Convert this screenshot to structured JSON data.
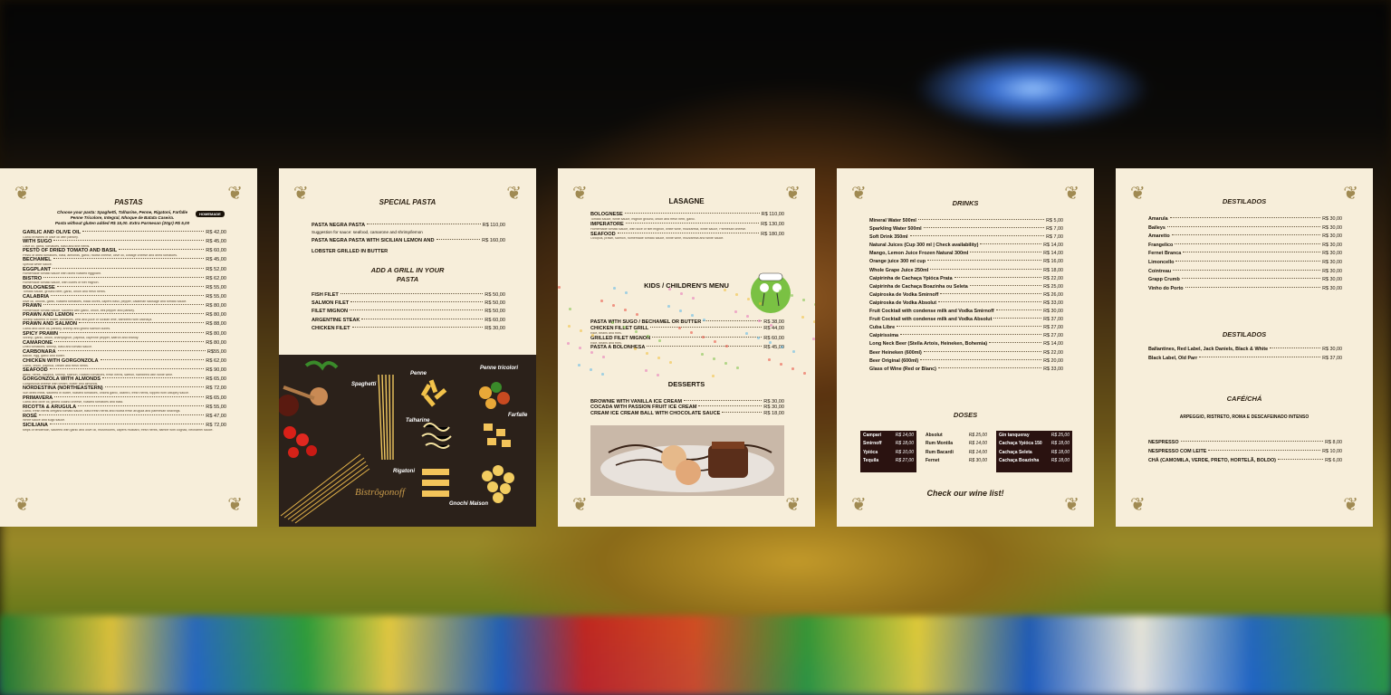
{
  "pastas": {
    "title": "PASTAS",
    "intro": [
      "Choose your pasta: Spaghetti, Talharine, Penne, Rigatoni, Farfalle",
      "Penne Tricolore, Integral, Nhoque de Batata Caseira.",
      "Pasta without gluten added R$ 15,00. Extra Parmesan (20gr) R$ 5,00"
    ],
    "badge": "HOMEMADE",
    "items": [
      {
        "name": "GARLIC AND OLIVE OIL",
        "price": "R$ 42,00",
        "desc": "Garlic browned in olive oil with parsley."
      },
      {
        "name": "WITH SUGO",
        "price": "R$ 45,00",
        "desc": "Olive oil, garlic, tomatoes, basil and fine herbs."
      },
      {
        "name": "PESTO OF DRIED TOMATO AND BASIL",
        "price": "R$ 60,00",
        "desc": "Pesto of dried tomatoes, basil, almonds, garlic, ricotta cheese, olive oil, cottage cheese and dried tomatoes."
      },
      {
        "name": "BECHAMEL",
        "price": "R$ 45,00",
        "desc": "Special white sauce."
      },
      {
        "name": "EGGPLANT",
        "price": "R$ 52,00",
        "desc": "Homemade tomato sauce with diced roasted eggplant."
      },
      {
        "name": "BISTRO",
        "price": "R$ 62,00",
        "desc": "Homemade tomato sauce, with cubes of filet mignon."
      },
      {
        "name": "BOLOGNESE",
        "price": "R$ 55,00",
        "desc": "Tomato sauce, ground beef, garlic, onion and fresh herbs."
      },
      {
        "name": "CALABRIA",
        "price": "R$ 55,00",
        "desc": "olive oil, onions, garlic, roasted tomatoes, black olives, capers basil, pepper, calabrian sausage and tomato sauce."
      },
      {
        "name": "PRAWN",
        "price": "R$ 80,00",
        "desc": "Homemade tomato sauce, sautéed with garlic, onion, bell pepper and parsley."
      },
      {
        "name": "PRAWN AND LEMON",
        "price": "R$ 80,00",
        "desc": "Shrimp sautéed in butter, tomatoes, zest and juice of Sicilian lime, flambéed with cachaça."
      },
      {
        "name": "PRAWN AND SALMON",
        "price": "R$ 88,00",
        "desc": "Garlic and olive oil, parsley, shrimp and grilled salmon cubes."
      },
      {
        "name": "SPICY PRAWN",
        "price": "R$ 80,00",
        "desc": "Shrimp, garlic, onion, champignon, paprika, cayenne pepper, saffron and brandy."
      },
      {
        "name": "CAMARONE",
        "price": "R$ 80,00",
        "desc": "Dried tomatoes, shrimp, basil and tomato sauce."
      },
      {
        "name": "CARBONARA",
        "price": "R$55,00",
        "desc": "Bacon, egg, garlic and butter."
      },
      {
        "name": "CHICKEN WITH GORGONZOLA",
        "price": "R$ 62,00",
        "desc": "Garlic, onion, paprika, cream and fresh herbs."
      },
      {
        "name": "SEAFOOD",
        "price": "R$ 90,00",
        "desc": "garlic, herbs, octopus, shrimp, salmon, roasted tomatoes, fresh herbs, saffron, flambéed with white wine."
      },
      {
        "name": "GORGONZOLA WITH ALMONDS",
        "price": "R$ 65,00",
        "desc": "Gorgonzola cheese with cream, butter and almonds."
      },
      {
        "name": "NORDESTINA (NORTHEASTERN)",
        "price": "R$ 72,00",
        "desc": "Sun dried meat, sautéed in butter, roasted tomatoes, onions garlic, cilantro, fresh herbs, topped with catupiry sauce."
      },
      {
        "name": "PRIMAVERA",
        "price": "R$ 65,00",
        "desc": "Garlic and olive oil, grilled coalho cheese, roasted tomatoes and basil."
      },
      {
        "name": "RICOTTA & ARUGULA",
        "price": "R$ 55,00",
        "desc": "Garlic, fresh herbs oregano tomato sauce, basil fresh herbs and ricotta fresh arugula and parmesan shavings."
      },
      {
        "name": "ROSÉ",
        "price": "R$ 47,00",
        "desc": "White sauce and sugo sauce."
      },
      {
        "name": "SICILIANA",
        "price": "R$ 72,00",
        "desc": "strips of tenderloin, sautéed with garlic and olive oil, mushrooms, capers mustard, fresh herbs, flambé with cognac, béchamel sauce."
      }
    ]
  },
  "special": {
    "title": "SPECIAL PASTA",
    "items": [
      {
        "name": "PASTA NEGRA PASTA",
        "price": "R$ 110,00"
      },
      {
        "name": "PASTA NEGRA PASTA WITH SICILIAN LEMON AND",
        "price": "R$ 160,00"
      }
    ],
    "note": "Suggestion for sauce: seafood, camarone and shrimp/lemon",
    "lobster": "LOBSTER GRILLED IN BUTTER",
    "grill_title": "ADD A GRILL IN YOUR PASTA",
    "grill": [
      {
        "name": "FISH FILET",
        "price": "R$ 50,00"
      },
      {
        "name": "SALMON FILET",
        "price": "R$ 50,00"
      },
      {
        "name": "FILET MIGNON",
        "price": "R$ 50,00"
      },
      {
        "name": "ARGENTINE STEAK",
        "price": "R$ 60,00"
      },
      {
        "name": "CHICKEN FILET",
        "price": "R$ 30,00"
      }
    ],
    "labels": {
      "spaghetti": "Spaghetti",
      "penne": "Penne",
      "penne_tri": "Penne tricolori",
      "talharine": "Talharine",
      "farfalle": "Farfalle",
      "rigatoni": "Rigatoni",
      "gnocchi": "Gnochi Maison"
    },
    "logo": "Bistrôgonoff"
  },
  "lasagne": {
    "title": "LASAGNE",
    "items": [
      {
        "name": "BOLOGNESE",
        "price": "R$ 110,00",
        "desc": "Tomato sauce, white sauce, mignon ground, onion and fresh herb, garlic."
      },
      {
        "name": "IMPERATORE",
        "price": "R$ 130,00",
        "desc": "Homemade tomato sauce, with slice of filet mignon, white wine, mozzarella, white sauce, Parmesan cheese."
      },
      {
        "name": "SEAFOOD",
        "price": "R$ 180,00",
        "desc": "Octopus, prawn, salmon, homemade tomato sauce, white wine, mozzarella and white sauce."
      }
    ],
    "kids_title": "KIDS / CHILDREN'S MENU",
    "kids": [
      {
        "name": "PASTA WITH SUGO / BECHAMEL OR BUTTER",
        "price": "R$ 38,00",
        "desc": ""
      },
      {
        "name": "CHICKEN FILLET GRILL",
        "price": "R$ 44,00",
        "desc": "Rice, beans and fries."
      },
      {
        "name": "GRILLED FILET MIGNON",
        "price": "R$ 60,00",
        "desc": "Rice, beans and fries."
      },
      {
        "name": "PASTA A BOLONHESA",
        "price": "R$ 45,00",
        "desc": ""
      }
    ],
    "desserts_title": "DESSERTS",
    "desserts": [
      {
        "name": "BROWNIE WITH VANILLA ICE CREAM",
        "price": "R$ 30,00"
      },
      {
        "name": "COCADA WITH PASSION FRUIT ICE CREAM",
        "price": "R$ 30,00"
      },
      {
        "name": "CREAM ICE CREAM BALL WITH CHOCOLATE SAUCE",
        "price": "R$ 18,00"
      }
    ]
  },
  "drinks": {
    "title": "DRINKS",
    "items": [
      {
        "name": "Mineral Water 500ml",
        "price": "R$ 5,00"
      },
      {
        "name": "Sparkling Water 500ml",
        "price": "R$ 7,00"
      },
      {
        "name": "Soft Drink 350ml",
        "price": "R$ 7,00"
      },
      {
        "name": "Natural Juices (Cup 300 ml | Check availability)",
        "price": "R$ 14,00"
      },
      {
        "name": "Mango, Lemon Juice Frozen Natural 300ml",
        "price": "R$ 14,00"
      },
      {
        "name": "Orange juice 300 ml cup",
        "price": "R$ 16,00"
      },
      {
        "name": "Whole Grape Juice 250ml",
        "price": "R$ 18,00"
      },
      {
        "name": "Caipirinha de Cachaça Ypióca Prata",
        "price": "R$ 22,00"
      },
      {
        "name": "Caipirinha de Cachaça Boazinha ou Seleta",
        "price": "R$ 25,00"
      },
      {
        "name": "Caipiroska de Vodka Smirnoff",
        "price": "R$ 26,00"
      },
      {
        "name": "Caipiroska de Vodka Absolut",
        "price": "R$ 33,00"
      },
      {
        "name": "Fruit Cocktail with condense milk and Vodka Smirnoff",
        "price": "R$ 30,00"
      },
      {
        "name": "Fruit Cocktail with condense milk and Vodka Absolut",
        "price": "R$ 37,00"
      },
      {
        "name": "Cuba Libre",
        "price": "R$ 27,00"
      },
      {
        "name": "Caipirissima",
        "price": "R$ 27,00"
      },
      {
        "name": "Long Neck Beer (Stella Artois, Heineken, Bohemia)",
        "price": "R$ 14,00"
      },
      {
        "name": "Beer Heineken (600ml)",
        "price": "R$ 22,00"
      },
      {
        "name": "Beer Original (600ml)",
        "price": "R$ 20,00"
      },
      {
        "name": "Glass of  Wine (Red or Blanc)",
        "price": "R$ 33,00"
      }
    ],
    "doses_title": "DOSES",
    "doses_left": [
      {
        "name": "Campari",
        "price": "R$ 14,00"
      },
      {
        "name": "Smirnoff",
        "price": "R$ 18,00"
      },
      {
        "name": "Ypióca",
        "price": "R$ 10,00"
      },
      {
        "name": "Tequila",
        "price": "R$ 27,00"
      }
    ],
    "doses_mid": [
      {
        "name": "Absolut",
        "price": "R$ 25,00"
      },
      {
        "name": "Rum Montila",
        "price": "R$ 14,00"
      },
      {
        "name": "Rum Bacardi",
        "price": "R$ 14,00"
      },
      {
        "name": "Fernet",
        "price": "R$ 30,00"
      }
    ],
    "doses_right": [
      {
        "name": "Gin tanqueray",
        "price": "R$ 25,00"
      },
      {
        "name": "Cachaça Ypióca 150",
        "price": "R$ 18,00"
      },
      {
        "name": "Cachaça Seleta",
        "price": "R$ 18,00"
      },
      {
        "name": "Cachaça Boazinha",
        "price": "R$ 18,00"
      }
    ],
    "wine_note": "Check our wine list!"
  },
  "destilados": {
    "title": "DESTILADOS",
    "items": [
      {
        "name": "Amarula",
        "price": "R$ 30,00"
      },
      {
        "name": "Baileys",
        "price": "R$ 30,00"
      },
      {
        "name": "Amaretto",
        "price": "R$ 30,00"
      },
      {
        "name": "Frangelico",
        "price": "R$ 30,00"
      },
      {
        "name": "Fernet Branca",
        "price": "R$ 30,00"
      },
      {
        "name": "Limoncello",
        "price": "R$ 30,00"
      },
      {
        "name": "Cointreau",
        "price": "R$ 30,00"
      },
      {
        "name": "Grapp Crumb",
        "price": "R$ 30,00"
      },
      {
        "name": "Vinho do Porto",
        "price": "R$ 30,00"
      }
    ],
    "title2": "DESTILADOS",
    "items2": [
      {
        "name": "Ballantines, Red Label, Jack Daniels, Black & White",
        "price": "R$ 30,00"
      },
      {
        "name": "Black Label, Old Parr",
        "price": "R$ 37,00"
      }
    ],
    "cafe_title": "CAFÉ/CHÁ",
    "cafe_note": "ARPEGGIO, RISTRETO, ROMA E DESCAFEINADO INTENSO",
    "cafe": [
      {
        "name": "NESPRESSO",
        "price": "R$ 8,00"
      },
      {
        "name": "NESPRESSO COM LEITE",
        "price": "R$ 10,00"
      },
      {
        "name": "CHÁ (CAMOMILA, VERDE, PRETO, HORTELÃ, BOLDO)",
        "price": "R$ 6,00"
      }
    ]
  }
}
